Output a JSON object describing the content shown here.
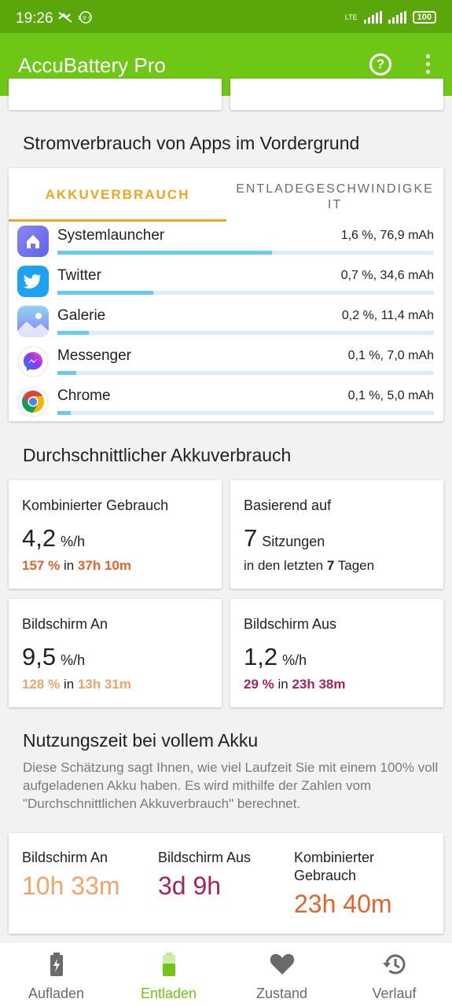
{
  "status": {
    "time": "19:26",
    "icons": "⚬⚬",
    "network": "LTE",
    "battery": "100"
  },
  "app": {
    "title": "AccuBattery Pro",
    "help_icon": "help-circle-icon",
    "menu_icon": "more-vert-icon"
  },
  "foreground": {
    "heading": "Stromverbrauch von Apps im Vordergrund",
    "tabs": [
      "AKKUVERBRAUCH",
      "ENTLADEGESCHWINDIGKE\nIT"
    ],
    "apps": [
      {
        "name": "Systemlauncher",
        "value": "1,6 %, 76,9 mAh",
        "fill": 0.57,
        "icon": "launcher-icon"
      },
      {
        "name": "Twitter",
        "value": "0,7 %, 34,6 mAh",
        "fill": 0.255,
        "icon": "twitter-icon"
      },
      {
        "name": "Galerie",
        "value": "0,2 %, 11,4 mAh",
        "fill": 0.083,
        "icon": "gallery-icon"
      },
      {
        "name": "Messenger",
        "value": "0,1 %, 7,0 mAh",
        "fill": 0.05,
        "icon": "messenger-icon"
      },
      {
        "name": "Chrome",
        "value": "0,1 %, 5,0 mAh",
        "fill": 0.036,
        "icon": "chrome-icon"
      }
    ]
  },
  "average": {
    "heading": "Durchschnittlicher Akkuverbrauch",
    "combined": {
      "label": "Kombinierter Gebrauch",
      "value": "4,2",
      "unit": "%/h",
      "pct": "157 %",
      "in": "in",
      "time": "37h 10m"
    },
    "based": {
      "label": "Basierend auf",
      "value": "7",
      "unit": "Sitzungen",
      "text_a": "in den letzten",
      "days": "7",
      "text_b": "Tagen"
    },
    "screen_on": {
      "label": "Bildschirm An",
      "value": "9,5",
      "unit": "%/h",
      "pct": "128 %",
      "in": "in",
      "time": "13h 31m"
    },
    "screen_off": {
      "label": "Bildschirm Aus",
      "value": "1,2",
      "unit": "%/h",
      "pct": "29 %",
      "in": "in",
      "time": "23h 38m"
    }
  },
  "full": {
    "heading": "Nutzungszeit bei vollem Akku",
    "description": "Diese Schätzung sagt Ihnen, wie viel Laufzeit Sie mit einem 100% voll aufgeladenen Akku haben. Es wird mithilfe der Zahlen vom \"Durchschnittlichen Akkuverbrauch\" berechnet.",
    "screen_on": {
      "label": "Bildschirm An",
      "value": "10h 33m"
    },
    "screen_off": {
      "label": "Bildschirm Aus",
      "value": "3d 9h"
    },
    "combined": {
      "label": "Kombinierter Gebrauch",
      "value": "23h 40m"
    }
  },
  "nav": [
    {
      "label": "Aufladen",
      "icon": "battery-charging-icon"
    },
    {
      "label": "Entladen",
      "icon": "battery-discharging-icon"
    },
    {
      "label": "Zustand",
      "icon": "heart-icon"
    },
    {
      "label": "Verlauf",
      "icon": "history-icon"
    }
  ],
  "colors": {
    "accent": "#6fc715",
    "tab": "#f2a41e",
    "combined": "#e8622c",
    "screen_on": "#f0a46a",
    "screen_off": "#a42462",
    "bar": "#6cc9f1"
  }
}
